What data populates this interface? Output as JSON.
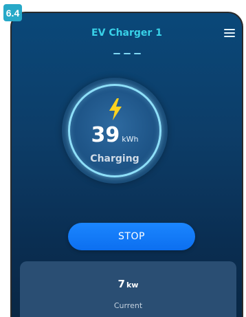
{
  "badge": "6.4",
  "header": {
    "title": "EV Charger 1",
    "menu_icon": "hamburger-menu-icon"
  },
  "pager": {
    "dots": 3
  },
  "gauge": {
    "icon": "lightning-bolt-icon",
    "value": "39",
    "unit": "kWh",
    "status": "Charging"
  },
  "actions": {
    "stop_label": "STOP"
  },
  "stats": {
    "value": "7",
    "unit": "kw",
    "label": "Current"
  },
  "colors": {
    "title": "#38d1e8",
    "accent": "#1b86ff",
    "bolt": "#ffd21e",
    "ring": "#8edff8"
  }
}
